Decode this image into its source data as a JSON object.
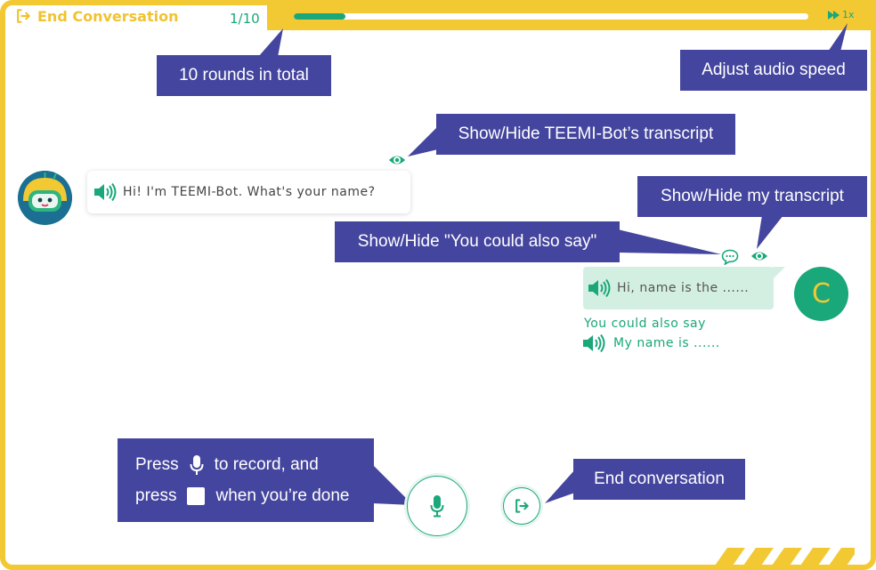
{
  "header": {
    "end_conversation_label": "End Conversation",
    "round_counter": "1/10",
    "progress_fraction": 0.1,
    "speed_label": "1x"
  },
  "callouts": {
    "rounds_total": "10 rounds in total",
    "audio_speed": "Adjust audio speed",
    "bot_transcript": "Show/Hide TEEMI-Bot’s transcript",
    "my_transcript": "Show/Hide my transcript",
    "could_also_say": "Show/Hide \"You could also say\"",
    "record_press": "Press",
    "record_to_record": "to record, and",
    "record_press2": "press",
    "record_when_done": "when you’re done",
    "end_conversation": "End conversation"
  },
  "chat": {
    "bot_message": "Hi! I'm TEEMI-Bot. What's your name?",
    "user_message": "Hi, name is the ......",
    "user_initial": "C",
    "also_say_label": "You could also say",
    "also_say_text": "My name is ......"
  },
  "colors": {
    "accent_yellow": "#f2c933",
    "accent_green": "#1aa77a",
    "callout_purple": "#44459e",
    "user_bubble": "#d3efe2"
  },
  "icons": {
    "end": "exit-icon",
    "speed": "fast-forward-icon",
    "eye": "eye-icon",
    "suggest": "chat-bubble-icon",
    "speaker": "speaker-icon",
    "mic": "microphone-icon",
    "stop": "stop-icon"
  }
}
